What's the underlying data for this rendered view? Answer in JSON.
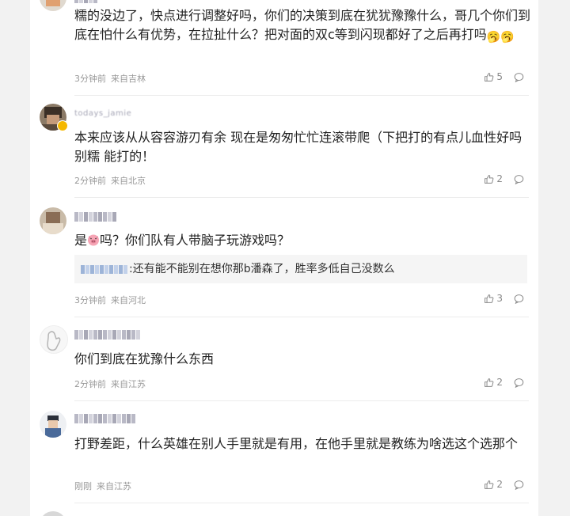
{
  "comments": [
    {
      "text": "糯的没边了，快点进行调整好吗，你们的决策到底在犹犹豫豫什么，哥几个你们到底在怕什么有优势，在拉扯什么？把对面的双c等到闪现都好了之后再打吗",
      "emoji": "🥱🥱",
      "time": "3分钟前",
      "location": "来自吉林",
      "likes": "5"
    },
    {
      "username": "todays_jamie",
      "text": "本来应该从从容容游刃有余 现在是匆匆忙忙连滚带爬（下把打的有点儿血性好吗别糯 能打的！",
      "time": "2分钟前",
      "location": "来自北京",
      "likes": "2"
    },
    {
      "text_before": "是",
      "text_after": "吗？你们队有人带脑子玩游戏吗？",
      "reply": ":还有能不能别在想你那b潘森了，胜率多低自己没数么",
      "time": "3分钟前",
      "location": "来自河北",
      "likes": "3"
    },
    {
      "text": "你们到底在犹豫什么东西",
      "time": "2分钟前",
      "location": "来自江苏",
      "likes": "2"
    },
    {
      "text": "打野差距，什么英雄在别人手里就是有用，在他手里就是教练为啥选这个选那个",
      "time": "刚刚",
      "location": "来自江苏",
      "likes": "2"
    }
  ],
  "colors": {
    "background": "#f2f2f2",
    "panel": "#ffffff",
    "text": "#222222",
    "meta": "#999999",
    "vip_badge": "#f5b800"
  },
  "icons": [
    "thumbs-up-icon",
    "comment-bubble-icon"
  ]
}
